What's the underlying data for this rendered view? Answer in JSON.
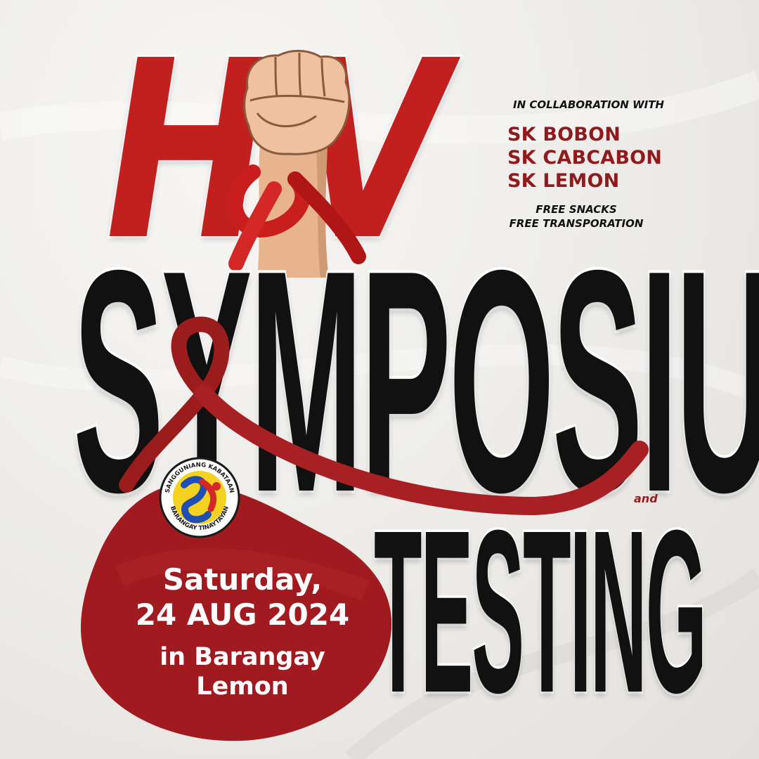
{
  "header": {
    "title_top": "HIV",
    "title_h": "H",
    "title_v": "V"
  },
  "title_main": "SYMPOSIUM",
  "title_connector": "and",
  "title_secondary": "TESTING",
  "collaboration": {
    "heading": "IN COLLABORATION WITH",
    "partners": [
      "SK BOBON",
      "SK CABCABON",
      "SK LEMON"
    ]
  },
  "perks": [
    "FREE SNACKS",
    "FREE TRANSPORATION"
  ],
  "event": {
    "day": "Saturday,",
    "date": "24 AUG 2024",
    "venue_line1": "in Barangay",
    "venue_line2": "Lemon"
  },
  "seal": {
    "top_text": "SANGGUNIANG KABATAAN",
    "bottom_text": "BARANGAY TINAYTAYAN",
    "icon": "sk-seal-icon"
  },
  "colors": {
    "primary_red": "#c21f1f",
    "dark_red": "#8f1b1e",
    "blob_red": "#a11a1f",
    "black": "#111111",
    "background": "#eeecea"
  }
}
